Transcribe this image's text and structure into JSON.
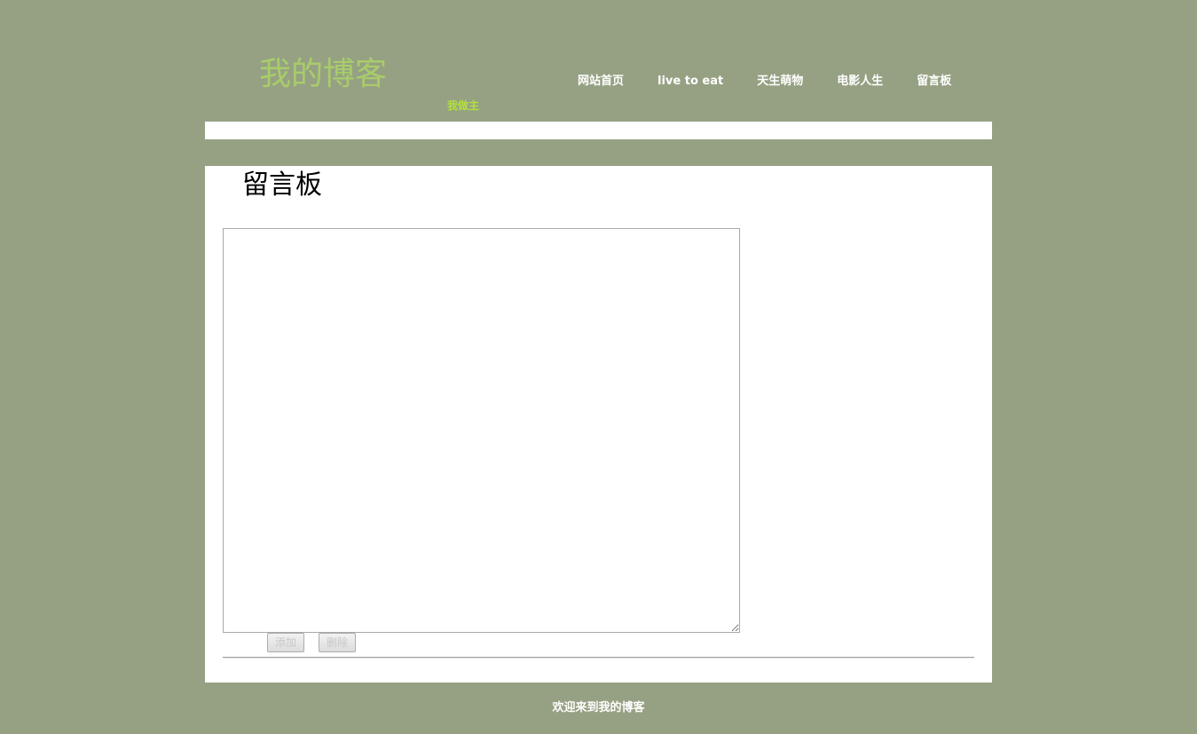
{
  "header": {
    "title": "我的博客",
    "subtitle": "我做主"
  },
  "nav": {
    "items": [
      {
        "label": "网站首页"
      },
      {
        "label": "live to eat"
      },
      {
        "label": "天生萌物"
      },
      {
        "label": "电影人生"
      },
      {
        "label": "留言板"
      }
    ]
  },
  "main": {
    "title": "留言板",
    "message": {
      "value": "",
      "placeholder": ""
    },
    "add_label": "添加",
    "delete_label": "删除"
  },
  "footer": {
    "text": "欢迎来到我的博客"
  },
  "colors": {
    "background": "#96a183",
    "site_title": "#a8cc6b",
    "subtitle": "#b3e13d",
    "panel": "#ffffff",
    "nav_text": "#ffffff"
  }
}
